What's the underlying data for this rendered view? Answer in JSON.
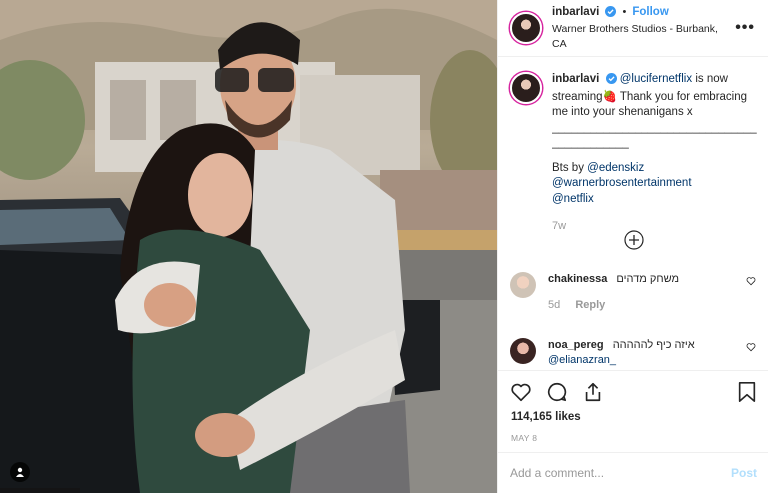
{
  "post": {
    "username": "inbarlavi",
    "follow_label": "Follow",
    "dot": "•",
    "location": "Warner Brothers Studios - Burbank, CA",
    "more_glyph": "•••"
  },
  "caption": {
    "username": "inbarlavi",
    "mention_main": "@lucifernetflix",
    "text_1": " is now streaming",
    "emoji": "🍓",
    "text_2": " Thank you for embracing me into your shenanigans x",
    "divider": "________________________________",
    "divider_2": "____________",
    "bts_label": "Bts by ",
    "mention_bts": "@edenskiz",
    "mention_wb": "@warnerbrosentertainment",
    "mention_netflix": "@netflix",
    "time_ago": "7w"
  },
  "comments": [
    {
      "username": "chakinessa",
      "text": "משחק מדהים",
      "age": "5d",
      "reply_label": "Reply"
    },
    {
      "username": "noa_pereg",
      "text": "איזה כיף לההההה",
      "mention": "@elianazran_"
    }
  ],
  "actions": {
    "likes": "114,165 likes",
    "date": "MAY 8"
  },
  "add_comment": {
    "placeholder": "Add a comment...",
    "post_label": "Post"
  },
  "colors": {
    "link_blue": "#3897f0",
    "mention_navy": "#003569",
    "muted": "#999999",
    "post_disabled": "#b2dffc"
  }
}
